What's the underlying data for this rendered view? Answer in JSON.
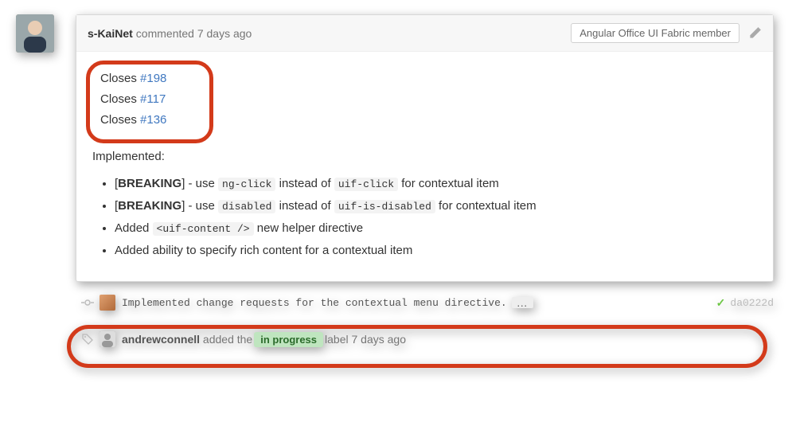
{
  "comment": {
    "author": "s-KaiNet",
    "action_text": "commented",
    "timestamp": "7 days ago",
    "badge": "Angular Office UI Fabric member",
    "closes_prefix": "Closes",
    "closes": [
      "#198",
      "#117",
      "#136"
    ],
    "implemented_heading": "Implemented:",
    "changes": [
      {
        "prefix": "[",
        "tag": "BREAKING",
        "suffix": "] - use ",
        "code1": "ng-click",
        "mid": " instead of ",
        "code2": "uif-click",
        "tail": " for contextual item"
      },
      {
        "prefix": "[",
        "tag": "BREAKING",
        "suffix": "] - use ",
        "code1": "disabled",
        "mid": " instead of ",
        "code2": "uif-is-disabled",
        "tail": " for contextual item"
      },
      {
        "plain_a": "Added ",
        "code1": "<uif-content />",
        "plain_b": " new helper directive"
      },
      {
        "plain_a": "Added ability to specify rich content for a contextual item"
      }
    ]
  },
  "commit_event": {
    "message": "Implemented change requests for the contextual menu directive.",
    "ellipsis": "…",
    "status_icon": "✓",
    "sha": "da0222d"
  },
  "label_event": {
    "actor": "andrewconnell",
    "action_a": "added the",
    "label": "in progress",
    "action_b": "label",
    "timestamp": "7 days ago"
  }
}
